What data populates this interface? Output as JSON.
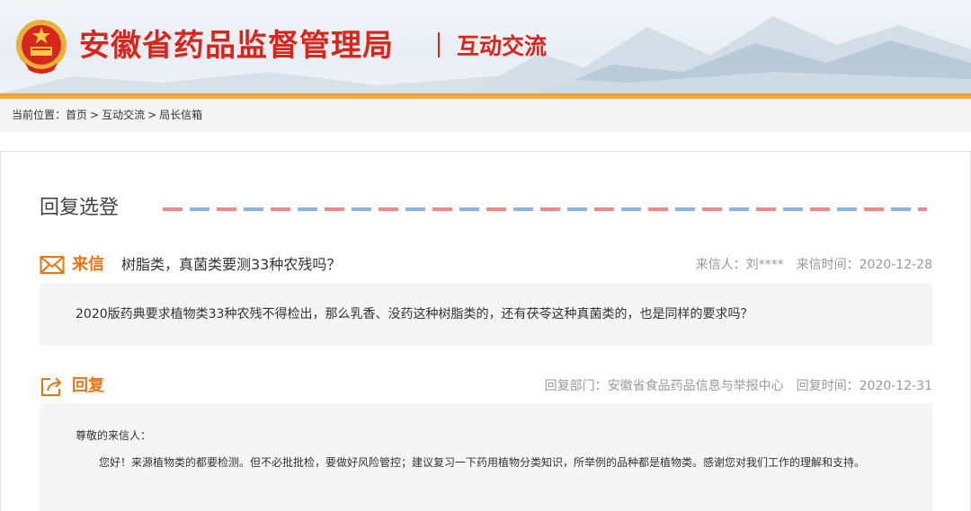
{
  "header": {
    "site_title": "安徽省药品监督管理局",
    "section_title": "互动交流"
  },
  "breadcrumb": {
    "prefix": "当前位置：",
    "items": [
      "首页",
      "互动交流",
      "局长信箱"
    ],
    "separator": ">"
  },
  "panel": {
    "heading": "回复选登"
  },
  "letter": {
    "label": "来信",
    "subject": "树脂类，真菌类要测33种农残吗？",
    "sender_label": "来信人：",
    "sender": "刘****",
    "time_label": "来信时间：",
    "time": "2020-12-28",
    "body": "2020版药典要求植物类33种农残不得检出，那么乳香、没药这种树脂类的，还有茯苓这种真菌类的，也是同样的要求吗？"
  },
  "reply": {
    "label": "回复",
    "dept_label": "回复部门：",
    "dept": "安徽省食品药品信息与举报中心",
    "time_label": "回复时间：",
    "time": "2020-12-31",
    "greeting": "尊敬的来信人：",
    "body": "您好！来源植物类的都要检测。但不必批批检，要做好风险管控；建议复习一下药用植物分类知识，所举例的品种都是植物类。感谢您对我们工作的理解和支持。"
  },
  "colors": {
    "title_red": "#d8261c",
    "accent_orange": "#e8741a",
    "airmail_red": "#f08a8a",
    "airmail_blue": "#8bb3e6"
  },
  "icons": {
    "emblem": "national-emblem-icon",
    "letter": "envelope-icon",
    "reply": "share-reply-icon"
  }
}
